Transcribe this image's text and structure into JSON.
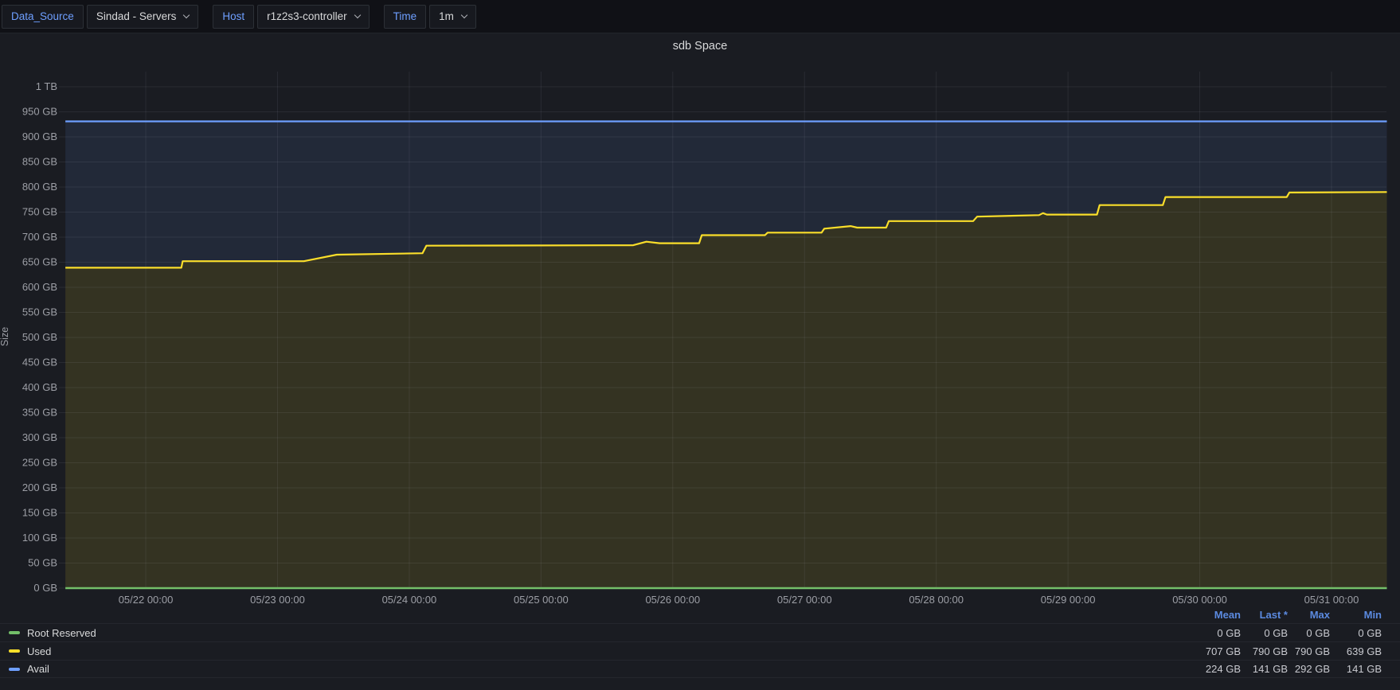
{
  "toolbar": {
    "data_source_label": "Data_Source",
    "data_source_value": "Sindad - Servers",
    "host_label": "Host",
    "host_value": "r1z2s3-controller",
    "time_label": "Time",
    "time_value": "1m"
  },
  "panel": {
    "title": "sdb Space"
  },
  "legend": {
    "headers": [
      "Mean",
      "Last *",
      "Max",
      "Min"
    ]
  },
  "chart_data": {
    "type": "area",
    "stacked": true,
    "title": "sdb Space",
    "xlabel": "",
    "ylabel": "Size",
    "unit": "GB",
    "ylim": [
      0,
      1000
    ],
    "grid": true,
    "legend_position": "bottom-table",
    "x_unit": "days since 05/21 00:00",
    "yticks": [
      {
        "value": 0,
        "label": "0 GB"
      },
      {
        "value": 50,
        "label": "50 GB"
      },
      {
        "value": 100,
        "label": "100 GB"
      },
      {
        "value": 150,
        "label": "150 GB"
      },
      {
        "value": 200,
        "label": "200 GB"
      },
      {
        "value": 250,
        "label": "250 GB"
      },
      {
        "value": 300,
        "label": "300 GB"
      },
      {
        "value": 350,
        "label": "350 GB"
      },
      {
        "value": 400,
        "label": "400 GB"
      },
      {
        "value": 450,
        "label": "450 GB"
      },
      {
        "value": 500,
        "label": "500 GB"
      },
      {
        "value": 550,
        "label": "550 GB"
      },
      {
        "value": 600,
        "label": "600 GB"
      },
      {
        "value": 650,
        "label": "650 GB"
      },
      {
        "value": 700,
        "label": "700 GB"
      },
      {
        "value": 750,
        "label": "750 GB"
      },
      {
        "value": 800,
        "label": "800 GB"
      },
      {
        "value": 850,
        "label": "850 GB"
      },
      {
        "value": 900,
        "label": "900 GB"
      },
      {
        "value": 950,
        "label": "950 GB"
      },
      {
        "value": 1000,
        "label": "1 TB"
      }
    ],
    "xticks": [
      {
        "t": 1,
        "label": "05/22 00:00"
      },
      {
        "t": 2,
        "label": "05/23 00:00"
      },
      {
        "t": 3,
        "label": "05/24 00:00"
      },
      {
        "t": 4,
        "label": "05/25 00:00"
      },
      {
        "t": 5,
        "label": "05/26 00:00"
      },
      {
        "t": 6,
        "label": "05/27 00:00"
      },
      {
        "t": 7,
        "label": "05/28 00:00"
      },
      {
        "t": 8,
        "label": "05/29 00:00"
      },
      {
        "t": 9,
        "label": "05/30 00:00"
      },
      {
        "t": 10,
        "label": "05/31 00:00"
      }
    ],
    "series": [
      {
        "name": "Root Reserved",
        "color": "#73bf69",
        "fill_opacity": 0,
        "line_width": 2.6,
        "stats": {
          "mean": "0 GB",
          "last": "0 GB",
          "max": "0 GB",
          "min": "0 GB"
        },
        "points": [
          [
            0.39,
            0
          ],
          [
            10.42,
            0
          ]
        ]
      },
      {
        "name": "Used",
        "color": "#fade2a",
        "fill_opacity": 0.12,
        "line_width": 2.2,
        "stats": {
          "mean": "707 GB",
          "last": "790 GB",
          "max": "790 GB",
          "min": "639 GB"
        },
        "points": [
          [
            0.39,
            639
          ],
          [
            1.27,
            639
          ],
          [
            1.28,
            652
          ],
          [
            2.2,
            652
          ],
          [
            2.45,
            665
          ],
          [
            3.1,
            668
          ],
          [
            3.13,
            683
          ],
          [
            4.7,
            684
          ],
          [
            4.8,
            691
          ],
          [
            4.9,
            688
          ],
          [
            5.2,
            688
          ],
          [
            5.22,
            704
          ],
          [
            5.7,
            704
          ],
          [
            5.72,
            709
          ],
          [
            6.13,
            709
          ],
          [
            6.15,
            717
          ],
          [
            6.35,
            722
          ],
          [
            6.4,
            719
          ],
          [
            6.62,
            719
          ],
          [
            6.64,
            732
          ],
          [
            7.28,
            732
          ],
          [
            7.31,
            741
          ],
          [
            7.78,
            744
          ],
          [
            7.81,
            748
          ],
          [
            7.84,
            745
          ],
          [
            8.22,
            745
          ],
          [
            8.24,
            764
          ],
          [
            8.72,
            764
          ],
          [
            8.74,
            780
          ],
          [
            9.66,
            780
          ],
          [
            9.68,
            789
          ],
          [
            10.42,
            790
          ]
        ]
      },
      {
        "name": "Avail",
        "color": "#6e9fff",
        "fill_opacity": 0.1,
        "line_width": 2.2,
        "stacked_on": "Used",
        "stats": {
          "mean": "224 GB",
          "last": "141 GB",
          "max": "292 GB",
          "min": "141 GB"
        },
        "points": [
          [
            0.39,
            292
          ],
          [
            1.27,
            292
          ],
          [
            1.28,
            279
          ],
          [
            2.2,
            279
          ],
          [
            2.45,
            266
          ],
          [
            3.1,
            263
          ],
          [
            3.13,
            248
          ],
          [
            4.7,
            247
          ],
          [
            4.8,
            240
          ],
          [
            4.9,
            243
          ],
          [
            5.2,
            243
          ],
          [
            5.22,
            227
          ],
          [
            5.7,
            227
          ],
          [
            5.72,
            222
          ],
          [
            6.13,
            222
          ],
          [
            6.15,
            214
          ],
          [
            6.35,
            209
          ],
          [
            6.4,
            212
          ],
          [
            6.62,
            212
          ],
          [
            6.64,
            199
          ],
          [
            7.28,
            199
          ],
          [
            7.31,
            190
          ],
          [
            7.78,
            187
          ],
          [
            7.81,
            183
          ],
          [
            7.84,
            186
          ],
          [
            8.22,
            186
          ],
          [
            8.24,
            167
          ],
          [
            8.72,
            167
          ],
          [
            8.74,
            151
          ],
          [
            9.66,
            151
          ],
          [
            9.68,
            142
          ],
          [
            10.42,
            141
          ]
        ]
      }
    ]
  }
}
